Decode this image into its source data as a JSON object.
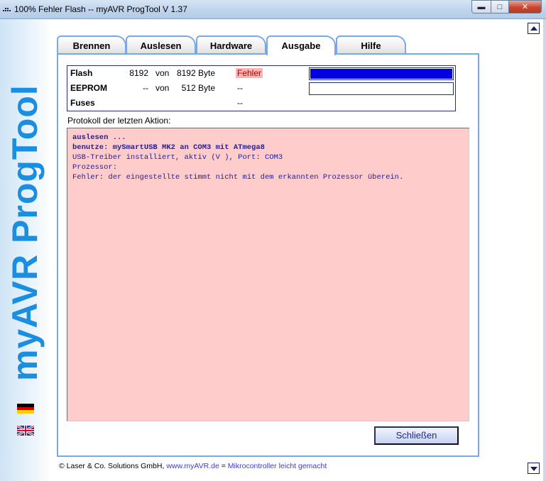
{
  "window": {
    "title": "100% Fehler Flash -- myAVR ProgTool V 1.37",
    "min_label": "▬",
    "max_label": "□",
    "close_label": "✕"
  },
  "sidebar": {
    "logo": "myAVR ProgTool",
    "flags": [
      "german-flag",
      "uk-flag"
    ]
  },
  "tabs": [
    {
      "label": "Brennen",
      "active": false
    },
    {
      "label": "Auslesen",
      "active": false
    },
    {
      "label": "Hardware",
      "active": false
    },
    {
      "label": "Ausgabe",
      "active": true
    },
    {
      "label": "Hilfe",
      "active": false
    }
  ],
  "memory": [
    {
      "label": "Flash",
      "value": "8192",
      "of": "von",
      "size": "8192 Byte",
      "status": "Fehler",
      "status_error": true,
      "progress": 1.0
    },
    {
      "label": "EEPROM",
      "value": "--",
      "of": "von",
      "size": "512 Byte",
      "status": "--",
      "status_error": false,
      "progress": 0.0
    },
    {
      "label": "Fuses",
      "value": "",
      "of": "",
      "size": "",
      "status": "--",
      "status_error": false
    }
  ],
  "log": {
    "caption": "Protokoll der letzten Aktion:",
    "lines": [
      {
        "text": "auslesen ...",
        "bold": true
      },
      {
        "text": "benutze: mySmartUSB MK2 an COM3 mit ATmega8",
        "bold": true
      },
      {
        "text": "USB-Treiber installiert, aktiv (V ), Port: COM3",
        "bold": false
      },
      {
        "text": "Prozessor:",
        "bold": false
      },
      {
        "text": "Fehler: der eingestellte stimmt nicht mit dem erkannten Prozessor überein.",
        "bold": false
      }
    ]
  },
  "close_button": "Schließen",
  "footer": {
    "company": "© Laser & Co. Solutions GmbH,",
    "link": "www.myAVR.de",
    "separator": "=",
    "slogan": "Mikrocontroller leicht gemacht"
  },
  "colors": {
    "accent": "#78a8e6",
    "logo": "#1a8ee0",
    "progress": "#0000e0",
    "log_bg": "#ffcccc",
    "error_bg": "#ffb3b3"
  }
}
